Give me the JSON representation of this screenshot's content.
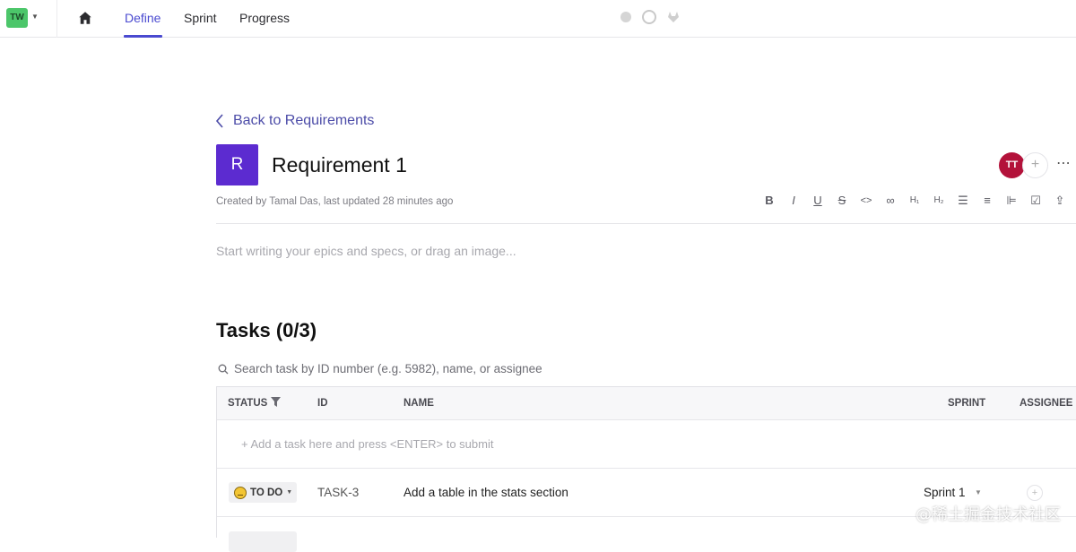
{
  "workspace": {
    "initials": "TW"
  },
  "nav": {
    "tabs": [
      "Define",
      "Sprint",
      "Progress"
    ],
    "active": "Define"
  },
  "page": {
    "back_label": "Back to Requirements",
    "avatar_letter": "R",
    "title": "Requirement 1",
    "meta": "Created by Tamal Das, last updated 28 minutes ago",
    "editor_placeholder": "Start writing your epics and specs, or drag an image...",
    "user_initials": "TT"
  },
  "toolbar": {
    "items": [
      "B",
      "I",
      "U",
      "S",
      "<>",
      "link",
      "H1",
      "H2",
      "ul",
      "ol",
      "indent",
      "checklist",
      "export"
    ]
  },
  "tasks": {
    "title": "Tasks (0/3)",
    "search_placeholder": "Search task by ID number (e.g. 5982), name, or assignee",
    "columns": {
      "status": "STATUS",
      "id": "ID",
      "name": "NAME",
      "sprint": "SPRINT",
      "assignee": "ASSIGNEE"
    },
    "add_placeholder": "+ Add a task here and press <ENTER> to submit",
    "rows": [
      {
        "status": "TO DO",
        "id": "TASK-3",
        "name": "Add a table in the stats section",
        "sprint": "Sprint 1"
      }
    ]
  },
  "watermark": "@稀土掘金技术社区"
}
